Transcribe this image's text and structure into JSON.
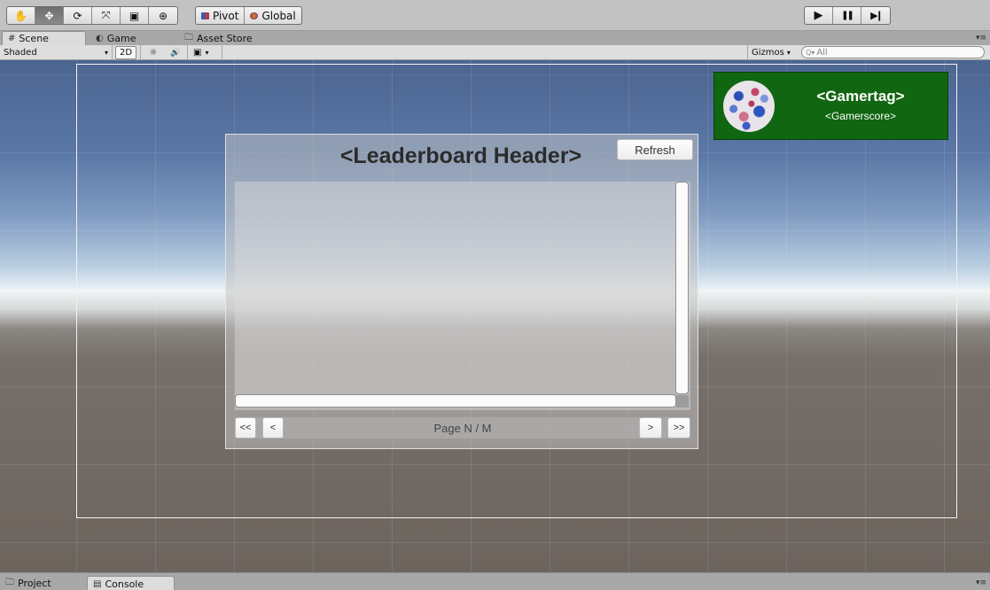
{
  "toolbar": {
    "tools": [
      {
        "name": "hand",
        "glyph": "✋"
      },
      {
        "name": "move",
        "glyph": "✥"
      },
      {
        "name": "rotate",
        "glyph": "⟳"
      },
      {
        "name": "scale",
        "glyph": "⤧"
      },
      {
        "name": "rect",
        "glyph": "▣"
      },
      {
        "name": "transform",
        "glyph": "⊕"
      }
    ],
    "active_tool": "move",
    "pivot_label": "Pivot",
    "global_label": "Global",
    "play_glyph": "▶",
    "pause_glyph": "❚❚",
    "step_glyph": "▶❙"
  },
  "tabs": [
    {
      "label": "Scene",
      "icon": "#"
    },
    {
      "label": "Game",
      "icon": "◐"
    },
    {
      "label": "Asset Store",
      "icon": "🗀"
    }
  ],
  "tab_menu_glyph": "▾≡",
  "scene_controls": {
    "shading_mode": "Shaded",
    "btn_2d": "2D",
    "light_glyph": "☼",
    "audio_glyph": "🔊",
    "fx_glyph": "▣",
    "gizmos_label": "Gizmos",
    "search_prefix": "Q▾",
    "search_placeholder": "All"
  },
  "leaderboard": {
    "header": "<Leaderboard Header>",
    "refresh_label": "Refresh",
    "page_label": "Page N / M",
    "first_label": "<<",
    "prev_label": "<",
    "next_label": ">",
    "last_label": ">>"
  },
  "profile": {
    "gamertag": "<Gamertag>",
    "gamerscore": "<Gamerscore>",
    "background_color": "#116611"
  },
  "bottom_tabs": [
    {
      "label": "Project",
      "icon": "🗀"
    },
    {
      "label": "Console",
      "icon": "▤"
    }
  ],
  "colors": {
    "profile_green": "#116611",
    "toolbar_gray": "#c2c2c2"
  }
}
